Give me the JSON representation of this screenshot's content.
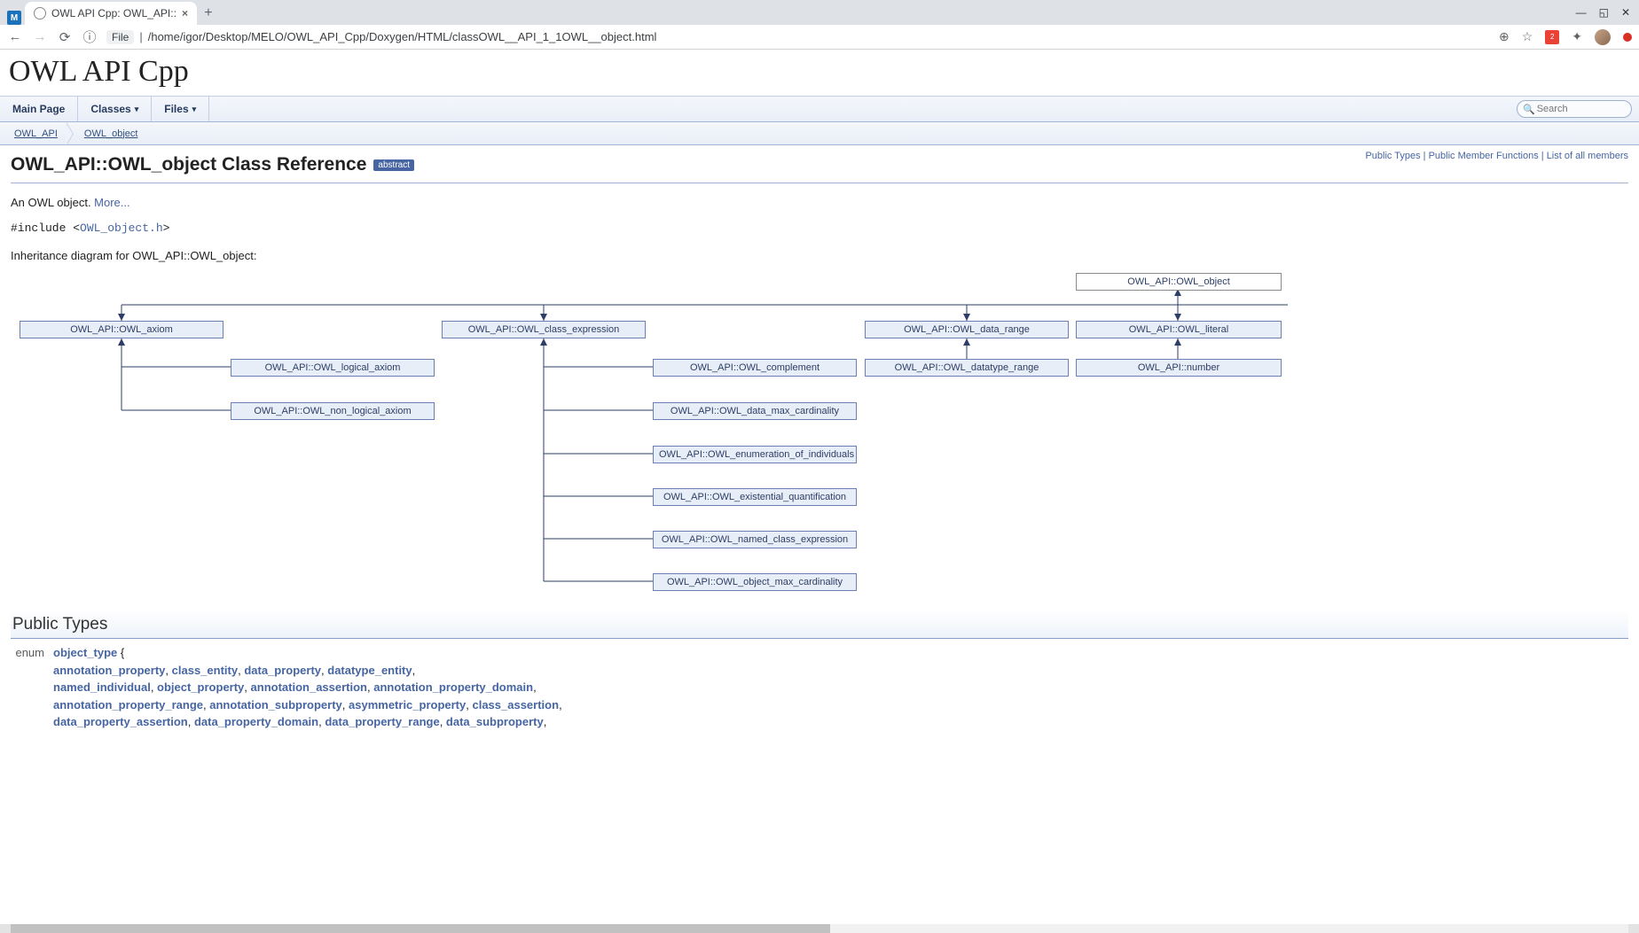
{
  "browser": {
    "tab_title": "OWL API Cpp: OWL_API::",
    "file_label": "File",
    "url_path": "/home/igor/Desktop/MELO/OWL_API_Cpp/Doxygen/HTML/classOWL__API_1_1OWL__object.html"
  },
  "project_title": "OWL API Cpp",
  "nav_tabs": {
    "main_page": "Main Page",
    "classes": "Classes",
    "files": "Files"
  },
  "search_placeholder": "Search",
  "breadcrumbs": {
    "c1": "OWL_API",
    "c2": "OWL_object"
  },
  "summary_links": {
    "l1": "Public Types",
    "l2": "Public Member Functions",
    "l3": "List of all members"
  },
  "page_heading": "OWL_API::OWL_object Class Reference",
  "abstract_tag": "abstract",
  "desc": {
    "text": "An OWL object. ",
    "more": "More..."
  },
  "include": {
    "prefix": "#include <",
    "file": "OWL_object.h",
    "suffix": ">"
  },
  "inh_label": "Inheritance diagram for OWL_API::OWL_object:",
  "diagram": {
    "root": "OWL_API::OWL_object",
    "n_axiom": "OWL_API::OWL_axiom",
    "n_class_expr": "OWL_API::OWL_class_expression",
    "n_data_range": "OWL_API::OWL_data_range",
    "n_literal": "OWL_API::OWL_literal",
    "n_logical_axiom": "OWL_API::OWL_logical_axiom",
    "n_non_logical_axiom": "OWL_API::OWL_non_logical_axiom",
    "n_complement": "OWL_API::OWL_complement",
    "n_data_max_card": "OWL_API::OWL_data_max_cardinality",
    "n_enum_ind": "OWL_API::OWL_enumeration_of_individuals",
    "n_exist_quant": "OWL_API::OWL_existential_quantification",
    "n_named_ce": "OWL_API::OWL_named_class_expression",
    "n_obj_max_card": "OWL_API::OWL_object_max_cardinality",
    "n_datatype_range": "OWL_API::OWL_datatype_range",
    "n_number": "OWL_API::number"
  },
  "public_types_heading": "Public Types",
  "enum_kw": "enum",
  "enum_name": "object_type",
  "enum_open": " {",
  "enum_values": [
    "annotation_property",
    "class_entity",
    "data_property",
    "datatype_entity",
    "named_individual",
    "object_property",
    "annotation_assertion",
    "annotation_property_domain",
    "annotation_property_range",
    "annotation_subproperty",
    "asymmetric_property",
    "class_assertion",
    "data_property_assertion",
    "data_property_domain",
    "data_property_range",
    "data_subproperty"
  ],
  "chart_data": {
    "type": "tree",
    "title": "Inheritance diagram for OWL_API::OWL_object",
    "root": "OWL_API::OWL_object",
    "children": [
      {
        "name": "OWL_API::OWL_axiom",
        "children": [
          {
            "name": "OWL_API::OWL_logical_axiom"
          },
          {
            "name": "OWL_API::OWL_non_logical_axiom"
          }
        ]
      },
      {
        "name": "OWL_API::OWL_class_expression",
        "children": [
          {
            "name": "OWL_API::OWL_complement"
          },
          {
            "name": "OWL_API::OWL_data_max_cardinality"
          },
          {
            "name": "OWL_API::OWL_enumeration_of_individuals"
          },
          {
            "name": "OWL_API::OWL_existential_quantification"
          },
          {
            "name": "OWL_API::OWL_named_class_expression"
          },
          {
            "name": "OWL_API::OWL_object_max_cardinality"
          }
        ]
      },
      {
        "name": "OWL_API::OWL_data_range",
        "children": [
          {
            "name": "OWL_API::OWL_datatype_range"
          }
        ]
      },
      {
        "name": "OWL_API::OWL_literal",
        "children": [
          {
            "name": "OWL_API::number"
          }
        ]
      }
    ]
  }
}
